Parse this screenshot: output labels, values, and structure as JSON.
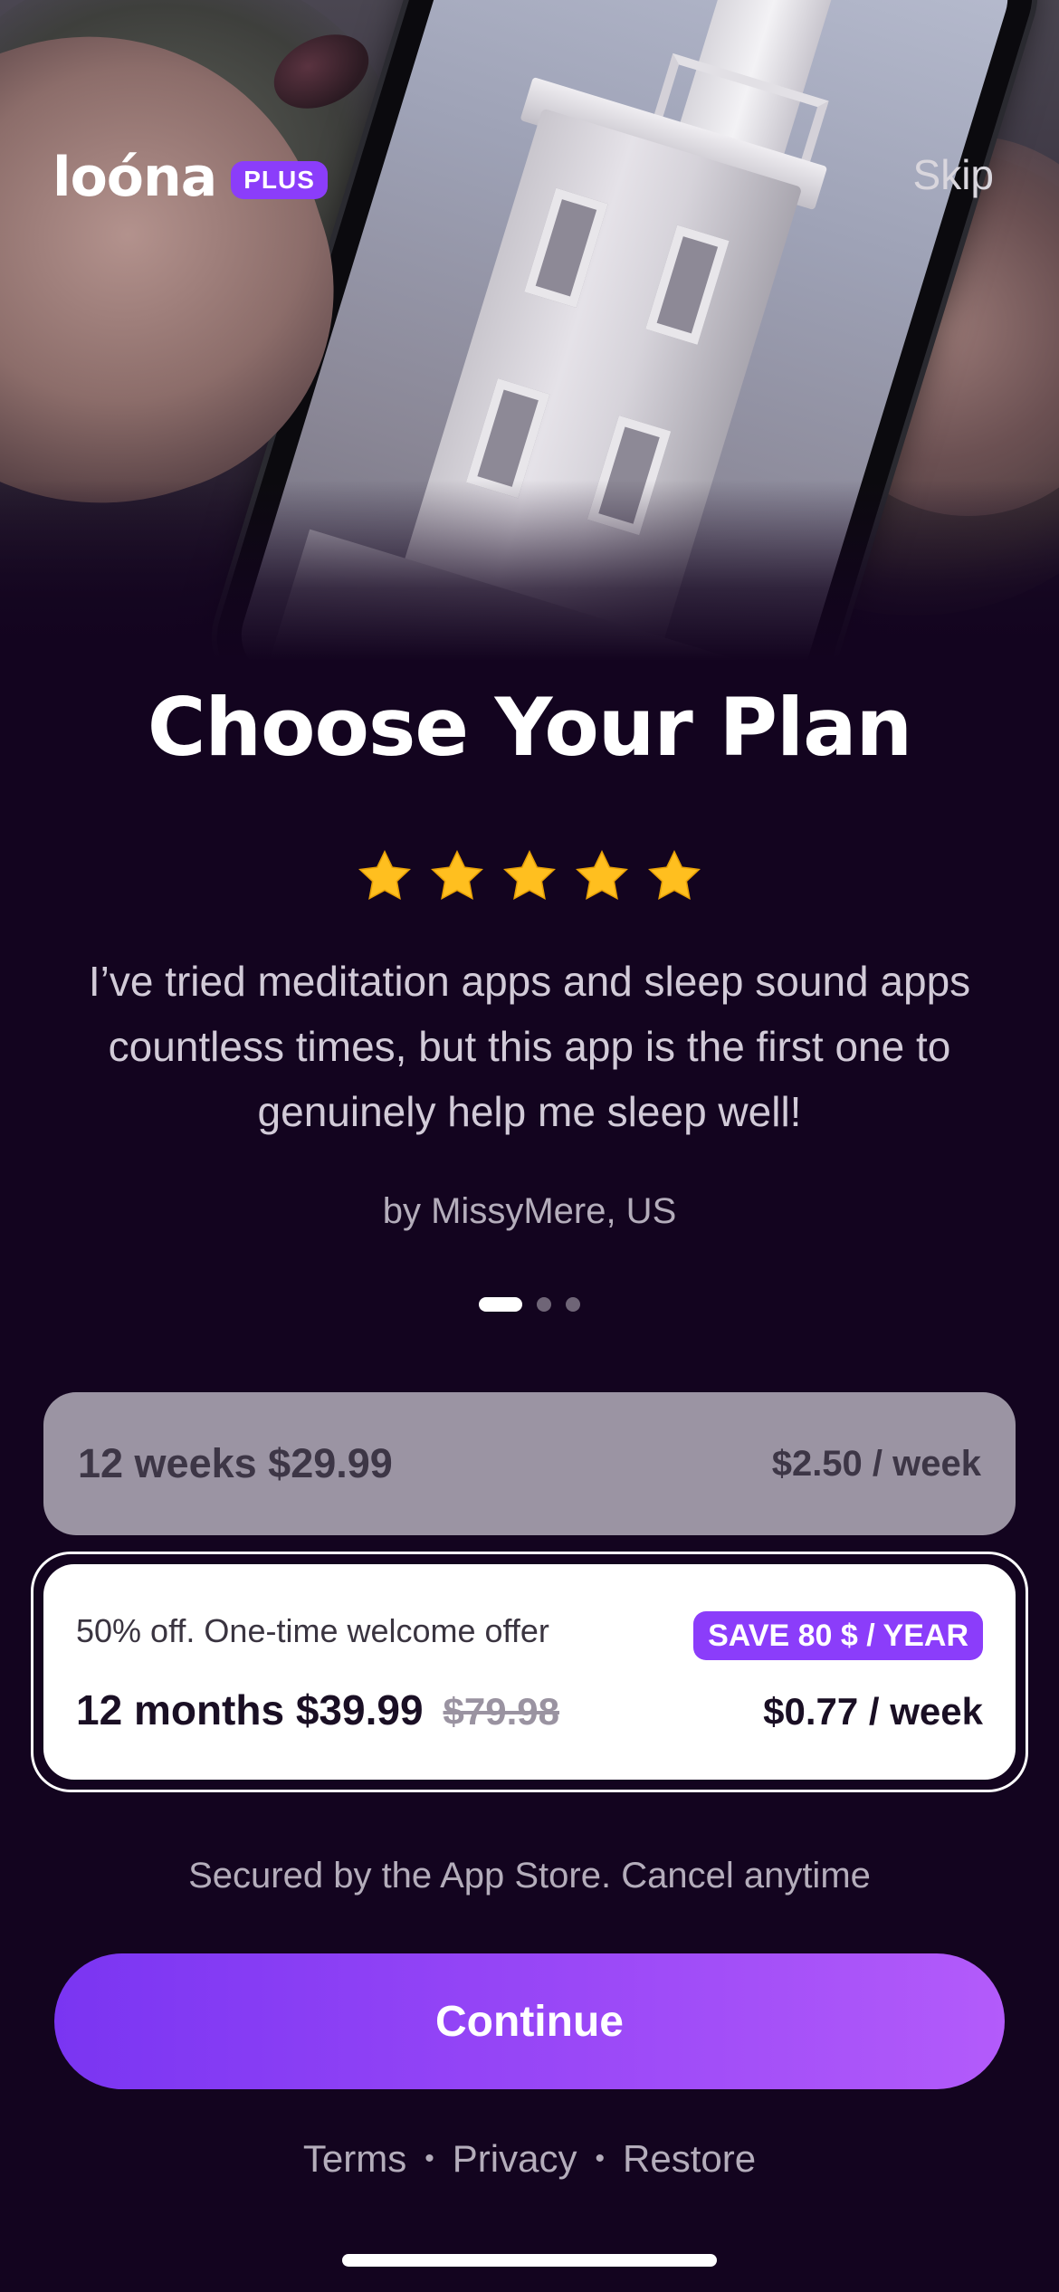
{
  "header": {
    "logo_text": "loóna",
    "plus_badge": "PLUS",
    "skip_label": "Skip"
  },
  "main": {
    "title": "Choose Your Plan",
    "rating_stars": 5,
    "review_text": "I’ve tried meditation apps and sleep sound apps countless times, but this app is the first one to genuinely help me sleep well!",
    "review_author": "by MissyMere, US",
    "carousel": {
      "pages": 3,
      "active_index": 0
    }
  },
  "plans": {
    "weekly": {
      "label": "12 weeks $29.99",
      "per_week": "$2.50 / week"
    },
    "annual": {
      "offer_text": "50% off. One-time welcome offer",
      "save_badge": "SAVE 80 $ / YEAR",
      "label": "12 months $39.99",
      "old_price": "$79.98",
      "per_week": "$0.77 / week",
      "selected": true
    }
  },
  "footer": {
    "secured_text": "Secured by the App Store. Cancel anytime",
    "continue_label": "Continue",
    "links": [
      "Terms",
      "Privacy",
      "Restore"
    ],
    "separator": "•"
  },
  "colors": {
    "background": "#13041f",
    "accent": "#8b3dfa",
    "star": "#ffbf1f",
    "muted_text": "#b4adbb",
    "unselected_plan": "#9b94a3"
  },
  "icons": {
    "star": "star-icon"
  }
}
